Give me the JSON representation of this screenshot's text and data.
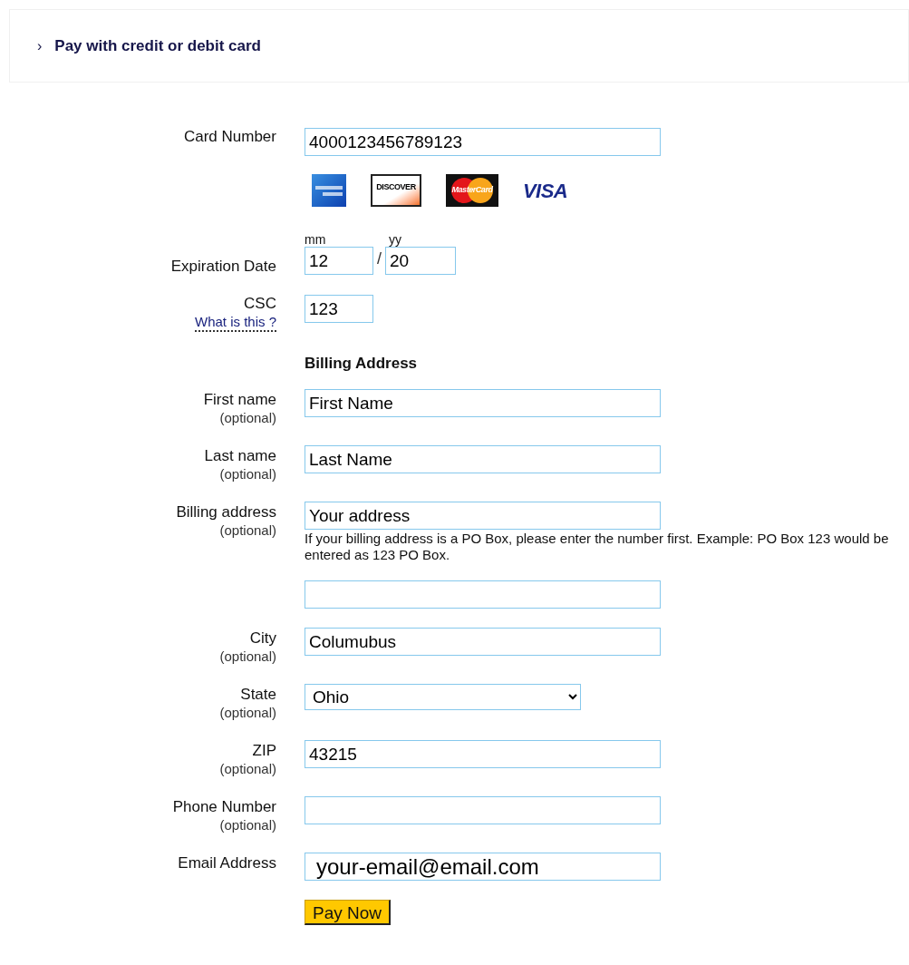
{
  "header": {
    "chevron": "›",
    "title": "Pay with credit or debit card"
  },
  "card_number": {
    "label": "Card Number",
    "value": "4000123456789123"
  },
  "card_logos": [
    {
      "kind": "amex"
    },
    {
      "kind": "discover",
      "text": "DISCOVER"
    },
    {
      "kind": "mastercard",
      "text": "MasterCard"
    },
    {
      "kind": "visa",
      "text": "VISA"
    }
  ],
  "expiration": {
    "label": "Expiration Date",
    "month_caption": "mm",
    "month": "12",
    "separator": "/",
    "year_caption": "yy",
    "year": "20"
  },
  "csc": {
    "label": "CSC",
    "link": "What is this ?",
    "value": "123"
  },
  "billing_heading": "Billing Address",
  "fields": [
    {
      "kind": "text",
      "label": "First name",
      "note": "(optional)",
      "value": "First Name"
    },
    {
      "kind": "text",
      "label": "Last name",
      "note": "(optional)",
      "value": "Last Name"
    },
    {
      "kind": "text",
      "label": "Billing address",
      "note": "(optional)",
      "value": "Your address",
      "help": "If your billing address is a PO Box, please enter the number first. Example: PO Box 123 would be entered as 123 PO Box."
    },
    {
      "kind": "text"
    },
    {
      "kind": "text",
      "label": "City",
      "note": "(optional)",
      "value": "Columubus"
    },
    {
      "kind": "select",
      "label": "State",
      "note": "(optional)",
      "value": "Ohio"
    },
    {
      "kind": "text",
      "label": "ZIP",
      "note": "(optional)",
      "value": "43215"
    },
    {
      "kind": "text",
      "label": "Phone Number",
      "note": "(optional)"
    },
    {
      "kind": "email",
      "label": "Email Address",
      "value": "your-email@email.com"
    }
  ],
  "submit": "Pay Now"
}
